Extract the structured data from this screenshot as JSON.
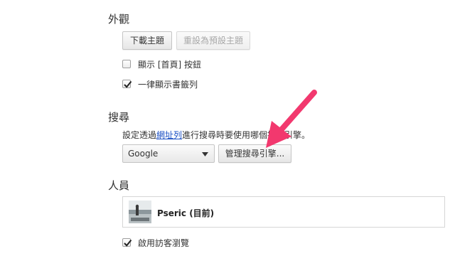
{
  "appearance": {
    "title": "外觀",
    "download_theme_label": "下載主題",
    "reset_theme_label": "重設為預設主題",
    "show_home_label": "顯示 [首頁] 按鈕",
    "show_home_checked": false,
    "show_bookmarks_label": "一律顯示書籤列",
    "show_bookmarks_checked": true
  },
  "search": {
    "title": "搜尋",
    "description_prefix": "設定透過",
    "description_link": "網址列",
    "description_suffix": "進行搜尋時要使用哪個搜尋引擎。",
    "engine_selected": "Google",
    "manage_label": "管理搜尋引擎..."
  },
  "people": {
    "title": "人員",
    "profile_name": "Pseric (目前)",
    "guest_browsing_label": "啟用訪客瀏覽",
    "guest_browsing_checked": true
  },
  "colors": {
    "arrow": "#f2386e",
    "link": "#1a4fc4"
  },
  "icons": {
    "checkmark": "checkmark-icon",
    "dropdown_caret": "chevron-down-icon",
    "annotation": "pointer-arrow-icon"
  }
}
